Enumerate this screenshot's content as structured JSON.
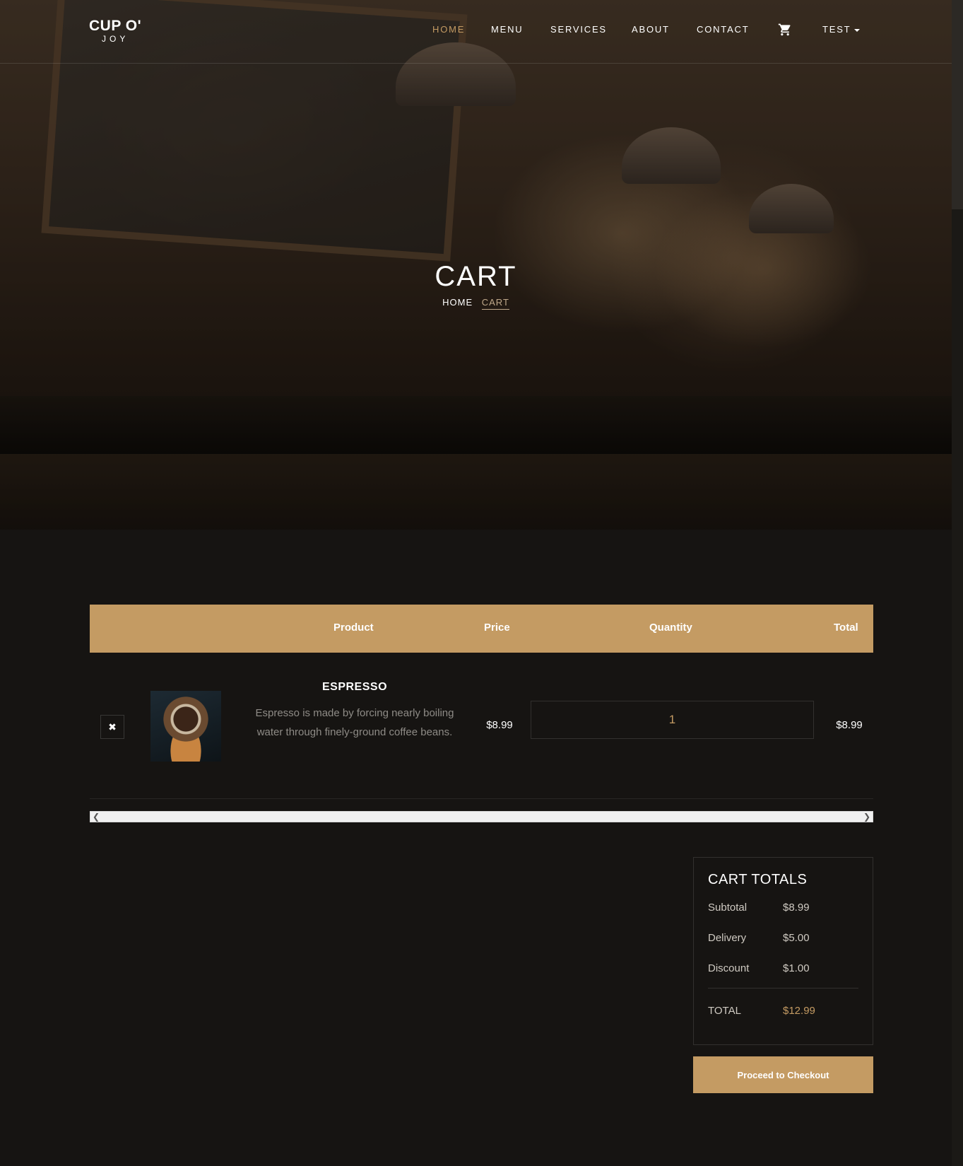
{
  "brand": {
    "line1": "CUP O'",
    "line2": "JOY"
  },
  "nav": {
    "items": [
      {
        "label": "HOME",
        "active": true
      },
      {
        "label": "MENU"
      },
      {
        "label": "SERVICES"
      },
      {
        "label": "ABOUT"
      },
      {
        "label": "CONTACT"
      }
    ],
    "cart_icon": "cart-icon",
    "user_label": "TEST"
  },
  "hero": {
    "title": "CART",
    "breadcrumb_home": "HOME",
    "breadcrumb_current": "CART"
  },
  "table": {
    "headers": [
      "Product",
      "Price",
      "Quantity",
      "Total"
    ],
    "rows": [
      {
        "remove_icon": "close-icon",
        "name": "ESPRESSO",
        "description": "Espresso is made by forcing nearly boiling water through finely-ground coffee beans.",
        "price": "$8.99",
        "quantity": "1",
        "total": "$8.99"
      }
    ]
  },
  "totals": {
    "title": "CART TOTALS",
    "subtotal_label": "Subtotal",
    "subtotal": "$8.99",
    "delivery_label": "Delivery",
    "delivery": "$5.00",
    "discount_label": "Discount",
    "discount": "$1.00",
    "total_label": "TOTAL",
    "total": "$12.99"
  },
  "checkout_label": "Proceed to Checkout",
  "colors": {
    "accent": "#c49b63",
    "background": "#161412"
  }
}
